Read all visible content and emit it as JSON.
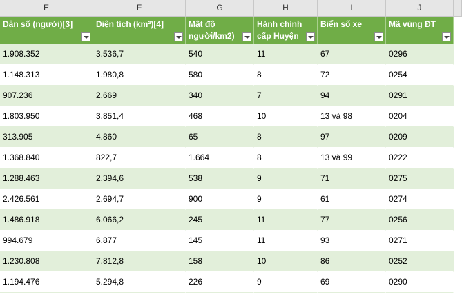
{
  "columns": [
    "E",
    "F",
    "G",
    "H",
    "I",
    "J",
    ""
  ],
  "headers": [
    [
      "Dân số (người)[3]"
    ],
    [
      "Diện tích (km²)[4]"
    ],
    [
      "Mật độ",
      "người/km2)"
    ],
    [
      "Hành chính",
      "cấp Huyện"
    ],
    [
      "Biển số xe"
    ],
    [
      "Mã vùng ĐT"
    ]
  ],
  "rows": [
    [
      "1.908.352",
      "3.536,7",
      "540",
      "11",
      "67",
      "0296"
    ],
    [
      "1.148.313",
      "1.980,8",
      "580",
      "8",
      "72",
      "0254"
    ],
    [
      "907.236",
      "2.669",
      "340",
      "7",
      "94",
      "0291"
    ],
    [
      "1.803.950",
      "3.851,4",
      "468",
      "10",
      "13 và 98",
      "0204"
    ],
    [
      "313.905",
      "4.860",
      "65",
      "8",
      "97",
      "0209"
    ],
    [
      "1.368.840",
      "822,7",
      "1.664",
      "8",
      "13 và 99",
      "0222"
    ],
    [
      "1.288.463",
      "2.394,6",
      "538",
      "9",
      "71",
      "0275"
    ],
    [
      "2.426.561",
      "2.694,7",
      "900",
      "9",
      "61",
      "0274"
    ],
    [
      "1.486.918",
      "6.066,2",
      "245",
      "11",
      "77",
      "0256"
    ],
    [
      "994.679",
      "6.877",
      "145",
      "11",
      "93",
      "0271"
    ],
    [
      "1.230.808",
      "7.812,8",
      "158",
      "10",
      "86",
      "0252"
    ],
    [
      "1.194.476",
      "5.294,8",
      "226",
      "9",
      "69",
      "0290"
    ]
  ],
  "header_color": "#70ad47",
  "band_color": "#e2efda"
}
